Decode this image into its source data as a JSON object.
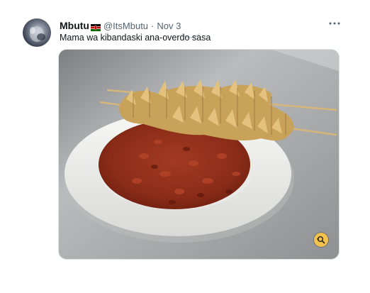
{
  "tweet": {
    "author_name": "Mbutu",
    "author_handle": "@ItsMbutu",
    "separator": "·",
    "date": "Nov 3",
    "text": "Mama wa kibandaski ana-overdo sasa",
    "more_icon": "more-horizontal-icon",
    "flag_icon": "kenya-flag-icon",
    "media": {
      "description_icon": "food-photo",
      "overlay_icon": "zoom-icon"
    }
  },
  "colors": {
    "name": "#0f1419",
    "secondary": "#536471",
    "zoom_badge": "#f2c14e"
  }
}
